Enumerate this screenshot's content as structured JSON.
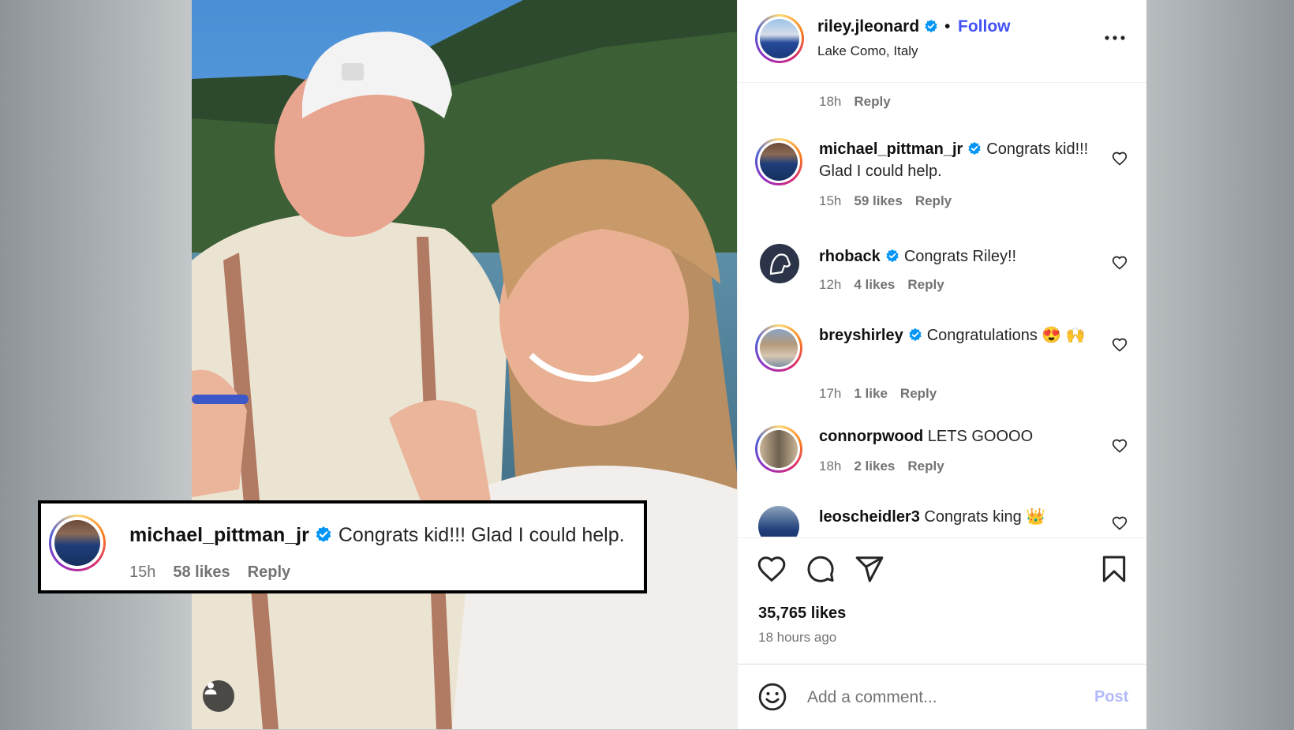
{
  "post": {
    "username": "riley.jleonard",
    "separator": "•",
    "follow_label": "Follow",
    "location": "Lake Como, Italy"
  },
  "comments": {
    "first_tail": {
      "time": "18h",
      "reply": "Reply"
    },
    "items": [
      {
        "user": "michael_pittman_jr",
        "verified": true,
        "text": "Congrats kid!!! Glad I could help.",
        "time": "15h",
        "likes": "59 likes",
        "reply": "Reply"
      },
      {
        "user": "rhoback",
        "verified": true,
        "text": "Congrats Riley!!",
        "time": "12h",
        "likes": "4 likes",
        "reply": "Reply"
      },
      {
        "user": "breyshirley",
        "verified": true,
        "text": "Congratulations 😍 🙌",
        "time": "17h",
        "likes": "1 like",
        "reply": "Reply"
      },
      {
        "user": "connorpwood",
        "verified": false,
        "text": "LETS GOOOO",
        "time": "18h",
        "likes": "2 likes",
        "reply": "Reply"
      },
      {
        "user": "leoscheidler3",
        "verified": false,
        "text": "Congrats king 👑"
      }
    ]
  },
  "stats": {
    "likes": "35,765 likes",
    "ago": "18 hours ago"
  },
  "compose": {
    "placeholder": "Add a comment...",
    "post_label": "Post"
  },
  "callout": {
    "user": "michael_pittman_jr",
    "text": "Congrats kid!!! Glad I could help.",
    "time": "15h",
    "likes": "58 likes",
    "reply": "Reply"
  },
  "icons": {
    "more": "more-options-icon",
    "like": "heart-icon",
    "comment": "comment-icon",
    "share": "share-icon",
    "save": "bookmark-icon",
    "emoji": "emoji-icon",
    "verified": "verified-badge-icon",
    "user_tag": "user-icon"
  },
  "colors": {
    "follow": "#4150f7",
    "verified": "#0095f6",
    "muted": "#737373",
    "post_disabled": "#b2bbf9"
  }
}
